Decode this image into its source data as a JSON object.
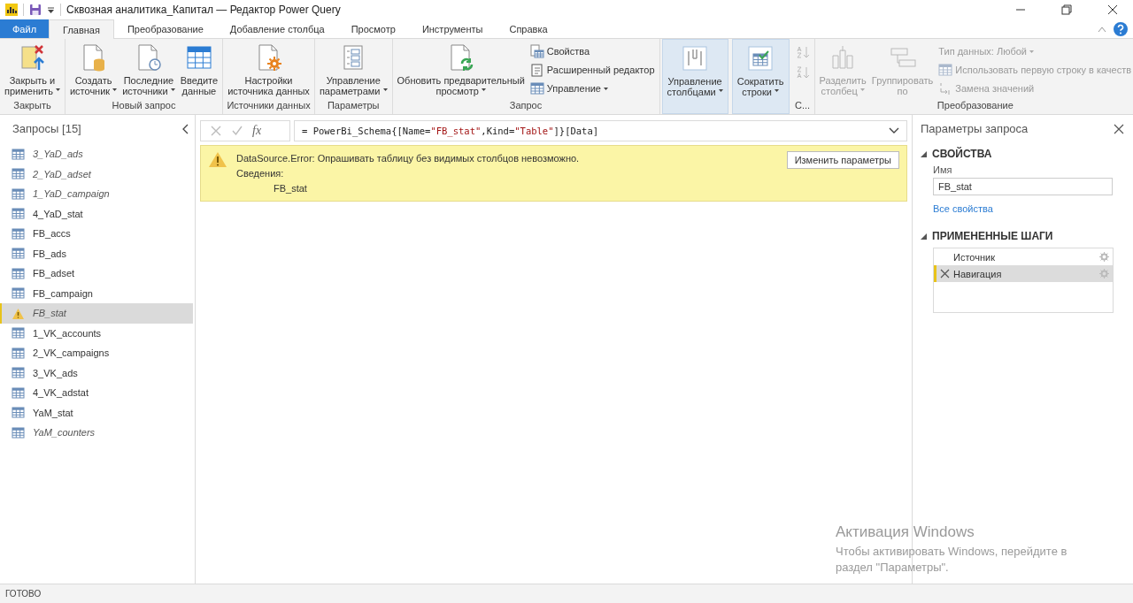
{
  "window": {
    "title": "Сквозная аналитика_Капитал — Редактор Power Query"
  },
  "tabs": [
    {
      "label": "Файл",
      "kind": "file",
      "selected": false
    },
    {
      "label": "Главная",
      "kind": "tab",
      "selected": true
    },
    {
      "label": "Преобразование",
      "kind": "tab",
      "selected": false
    },
    {
      "label": "Добавление столбца",
      "kind": "tab",
      "selected": false
    },
    {
      "label": "Просмотр",
      "kind": "tab",
      "selected": false
    },
    {
      "label": "Инструменты",
      "kind": "tab",
      "selected": false
    },
    {
      "label": "Справка",
      "kind": "tab",
      "selected": false
    }
  ],
  "ribbon": {
    "groups": [
      {
        "label": "Закрыть",
        "highlighted": false,
        "buttons": [
          {
            "kind": "large",
            "lines": [
              "Закрыть и",
              "применить"
            ],
            "dropdown": true,
            "disabled": false
          }
        ]
      },
      {
        "label": "Новый запрос",
        "highlighted": false,
        "buttons": [
          {
            "kind": "large",
            "lines": [
              "Создать",
              "источник"
            ],
            "dropdown": true,
            "disabled": false
          },
          {
            "kind": "large",
            "lines": [
              "Последние",
              "источники"
            ],
            "dropdown": true,
            "disabled": false
          },
          {
            "kind": "large",
            "lines": [
              "Введите",
              "данные"
            ],
            "dropdown": false,
            "disabled": false
          }
        ]
      },
      {
        "label": "Источники данных",
        "highlighted": false,
        "buttons": [
          {
            "kind": "large",
            "lines": [
              "Настройки",
              "источника данных"
            ],
            "dropdown": false,
            "disabled": false
          }
        ]
      },
      {
        "label": "Параметры",
        "highlighted": false,
        "buttons": [
          {
            "kind": "large",
            "lines": [
              "Управление",
              "параметрами"
            ],
            "dropdown": true,
            "disabled": false
          }
        ]
      },
      {
        "label": "Запрос",
        "highlighted": false,
        "buttons": [
          {
            "kind": "large",
            "lines": [
              "Обновить предварительный",
              "просмотр"
            ],
            "dropdown": true,
            "disabled": false
          },
          {
            "kind": "small",
            "lines": [
              "Свойства"
            ],
            "dropdown": false,
            "disabled": false
          },
          {
            "kind": "small",
            "lines": [
              "Расширенный редактор"
            ],
            "dropdown": false,
            "disabled": false
          },
          {
            "kind": "small",
            "lines": [
              "Управление"
            ],
            "dropdown": true,
            "disabled": false
          }
        ]
      },
      {
        "highlighted": true,
        "buttons": [
          {
            "kind": "large",
            "lines": [
              "Управление",
              "столбцами"
            ],
            "dropdown": true,
            "disabled": false
          }
        ]
      },
      {
        "highlighted": true,
        "buttons": [
          {
            "kind": "large",
            "lines": [
              "Сократить",
              "строки"
            ],
            "dropdown": true,
            "disabled": false
          }
        ]
      },
      {
        "label": "С...",
        "highlighted": false,
        "buttons": [
          {
            "kind": "icon",
            "dropdown": false,
            "disabled": true
          },
          {
            "kind": "icon",
            "dropdown": false,
            "disabled": true
          }
        ]
      },
      {
        "label": "Преобразование",
        "highlighted": false,
        "buttons": [
          {
            "kind": "large",
            "lines": [
              "Разделить",
              "столбец"
            ],
            "dropdown": true,
            "disabled": true
          },
          {
            "kind": "large",
            "lines": [
              "Группировать",
              "по"
            ],
            "dropdown": false,
            "disabled": true
          },
          {
            "kind": "small",
            "lines": [
              "Тип данных: Любой"
            ],
            "dropdown": true,
            "disabled": true
          },
          {
            "kind": "small",
            "lines": [
              "Использовать первую строку в качеств"
            ],
            "dropdown": false,
            "disabled": true
          },
          {
            "kind": "small",
            "lines": [
              "Замена значений"
            ],
            "dropdown": false,
            "disabled": true
          }
        ]
      }
    ]
  },
  "queries": {
    "title": "Запросы [15]",
    "items": [
      {
        "name": "3_YaD_ads",
        "kind": "table",
        "load_disabled": true,
        "selected": false
      },
      {
        "name": "2_YaD_adset",
        "kind": "table",
        "load_disabled": true,
        "selected": false
      },
      {
        "name": "1_YaD_campaign",
        "kind": "table",
        "load_disabled": true,
        "selected": false
      },
      {
        "name": "4_YaD_stat",
        "kind": "table",
        "load_disabled": false,
        "selected": false
      },
      {
        "name": "FB_accs",
        "kind": "table",
        "load_disabled": false,
        "selected": false
      },
      {
        "name": "FB_ads",
        "kind": "table",
        "load_disabled": false,
        "selected": false
      },
      {
        "name": "FB_adset",
        "kind": "table",
        "load_disabled": false,
        "selected": false
      },
      {
        "name": "FB_campaign",
        "kind": "table",
        "load_disabled": false,
        "selected": false
      },
      {
        "name": "FB_stat",
        "kind": "error",
        "load_disabled": true,
        "selected": true
      },
      {
        "name": "1_VK_accounts",
        "kind": "table",
        "load_disabled": false,
        "selected": false
      },
      {
        "name": "2_VK_campaigns",
        "kind": "table",
        "load_disabled": false,
        "selected": false
      },
      {
        "name": "3_VK_ads",
        "kind": "table",
        "load_disabled": false,
        "selected": false
      },
      {
        "name": "4_VK_adstat",
        "kind": "table",
        "load_disabled": false,
        "selected": false
      },
      {
        "name": "YaM_stat",
        "kind": "table",
        "load_disabled": false,
        "selected": false
      },
      {
        "name": "YaM_counters",
        "kind": "table",
        "load_disabled": true,
        "selected": false
      }
    ]
  },
  "formula_bar": {
    "function_label": "fx",
    "segments": [
      {
        "text": "= PowerBi_Schema{[Name=",
        "kind": "plain"
      },
      {
        "text": "\"FB_stat\"",
        "kind": "string"
      },
      {
        "text": ",Kind=",
        "kind": "plain"
      },
      {
        "text": "\"Table\"",
        "kind": "string"
      },
      {
        "text": "]}[Data]",
        "kind": "plain"
      }
    ]
  },
  "error": {
    "message": "DataSource.Error: Опрашивать таблицу без видимых столбцов невозможно.",
    "details_label": "Сведения:",
    "detail": "FB_stat",
    "button": "Изменить параметры"
  },
  "query_settings": {
    "title": "Параметры запроса",
    "properties": {
      "heading": "СВОЙСТВА",
      "expanded": true,
      "name_label": "Имя",
      "name_value": "FB_stat",
      "link": "Все свойства"
    },
    "steps_section": {
      "heading": "ПРИМЕНЕННЫЕ ШАГИ",
      "expanded": true
    },
    "steps": [
      {
        "name": "Источник",
        "error": false,
        "selected": false
      },
      {
        "name": "Навигация",
        "error": true,
        "selected": true
      }
    ]
  },
  "status_bar": {
    "text": "ГОТОВО"
  },
  "activation": {
    "title": "Активация Windows",
    "text": "Чтобы активировать Windows, перейдите в раздел \"Параметры\"."
  }
}
